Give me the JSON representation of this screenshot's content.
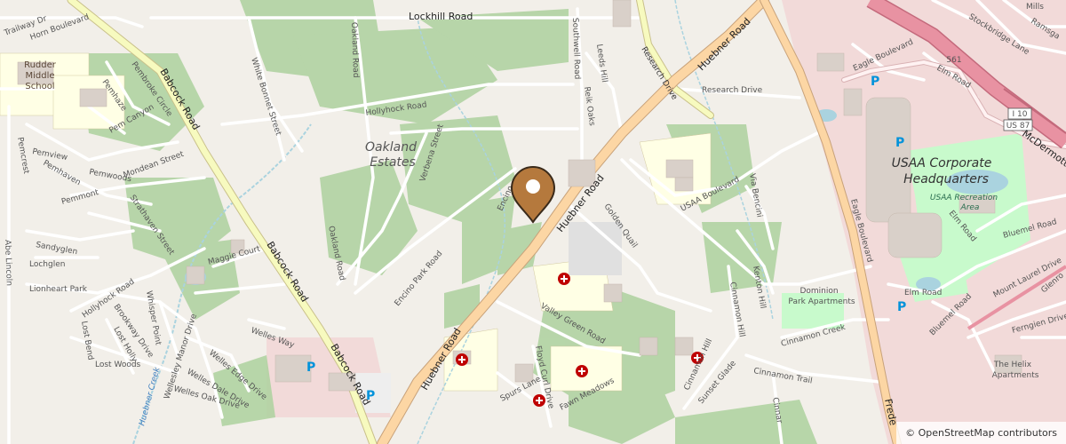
{
  "map": {
    "attribution": "© OpenStreetMap contributors",
    "colors": {
      "background": "#f2efe9",
      "wood": "#add19e",
      "park": "#c8facc",
      "commercial": "#f2dad9",
      "school": "#ffffe5",
      "major_road": "#fcd6a4",
      "secondary_road": "#f7fabf",
      "motorway": "#e892a2",
      "water": "#aad3df",
      "building": "#d9d0c9",
      "marker": "#b5793d"
    },
    "marker": {
      "name": "location-marker",
      "icon": "map-pin-icon"
    },
    "areas": {
      "oakland_estates_1": "Oakland",
      "oakland_estates_2": "Estates",
      "usaa_hq_1": "USAA Corporate",
      "usaa_hq_2": "Headquarters",
      "usaa_rec_1": "USAA Recreation",
      "usaa_rec_2": "Area",
      "dominion_1": "Dominion",
      "dominion_2": "Park Apartments",
      "helix_1": "The Helix",
      "helix_2": "Apartments",
      "rudder_1": "Rudder",
      "rudder_2": "Middle",
      "rudder_3": "School"
    },
    "roads": {
      "lockhill": "Lockhill Road",
      "babcock_1": "Babcock Road",
      "babcock_2": "Babcock Road",
      "babcock_3": "Babcock Road",
      "huebner_1": "Huebner Road",
      "huebner_2": "Huebner Road",
      "huebner_3": "Huebner Road",
      "research_drive_1": "Research Drive",
      "research_drive_2": "Research Drive",
      "usaa_blvd": "USAA Boulevard",
      "eagle_blvd_1": "Eagle Boulevard",
      "eagle_blvd_2": "Eagle Boulevard",
      "elm_road_1": "Elm Road",
      "elm_road_2": "Elm Road",
      "elm_road_3": "Elm Road",
      "mcdermott": "McDermott Fr",
      "fredericksburg": "Frede",
      "horn": "Horn Boulevard",
      "trailway": "Trailway Dr",
      "mills": "Mills",
      "stockbridge": "Stockbridge Lane",
      "ramsgate": "Ramsga",
      "oakland_road_1": "Oakland Road",
      "oakland_road_2": "Oakland Road",
      "white_bonnet": "White Bonnet Street",
      "hollyhock_1": "Hollyhock Road",
      "hollyhock_2": "Hollyhock Road",
      "verbena": "Verbena Street",
      "encino_1": "Encino",
      "encino_park": "Encino Park Road",
      "southwell": "Southwell Road",
      "leeds_hill": "Leeds Hill",
      "reik_oaks": "Reik Oaks",
      "golden_quail": "Golden Quail",
      "via_bencini": "Via Bencini",
      "kenton_hill": "Kenton Hill",
      "cinnamon_hill_1": "Cinnamon Hill",
      "cinnamon_hill_2": "Cinnamon Hill",
      "cinnamon_creek": "Cinnamon Creek",
      "cinnamon_trail": "Cinnamon Trail",
      "cinnamon_3": "Cinnar",
      "valley_green": "Valley Green Road",
      "floyd_curl": "Floyd Curl Drive",
      "spurs_lane": "Spurs Lane",
      "fawn_meadows": "Fawn Meadows",
      "sunset_glade": "Sunset Glade",
      "mount_laurel": "Mount Laurel Drive",
      "glenrose": "Glenro",
      "bluemel_1": "Bluemel Road",
      "bluemel_2": "Bluemel Road",
      "ferngien": "Ferngien Drive",
      "pembroke_circle": "Pembroke Circle",
      "pemhaze": "Pemhaze",
      "pem_canyon": "Pem Canyon",
      "pemcrest": "Pemcrest",
      "pemview": "Pemview",
      "pemhaven": "Pemhaven",
      "pemwoods": "Pemwoods",
      "pemmont": "Pemmont",
      "mondean": "Mondean Street",
      "strathaven": "Strathaven Street",
      "sandyglen": "Sandyglen",
      "lochglen": "Lochglen",
      "lionheart": "Lionheart Park",
      "abe_lincoln": "Abe Lincoln",
      "maggie": "Maggie Court",
      "whisper_point": "Whisper Point",
      "brookway": "Brookway Drive",
      "lost_holly": "Lost Holly",
      "lost_bend": "Lost Bend",
      "lost_woods": "Lost Woods",
      "welles_way": "Welles Way",
      "wellesley_manor": "Wellesley Manor Drive",
      "welles_oak": "Welles Oak Drive",
      "welles_dale": "Welles Dale Drive",
      "wellesl_edge": "Welles Edge Drive"
    },
    "water_labels": {
      "huebner_creek": "Huebner Creek"
    },
    "shields": {
      "i10": "I 10",
      "us87": "US 87",
      "r561": "561"
    }
  }
}
